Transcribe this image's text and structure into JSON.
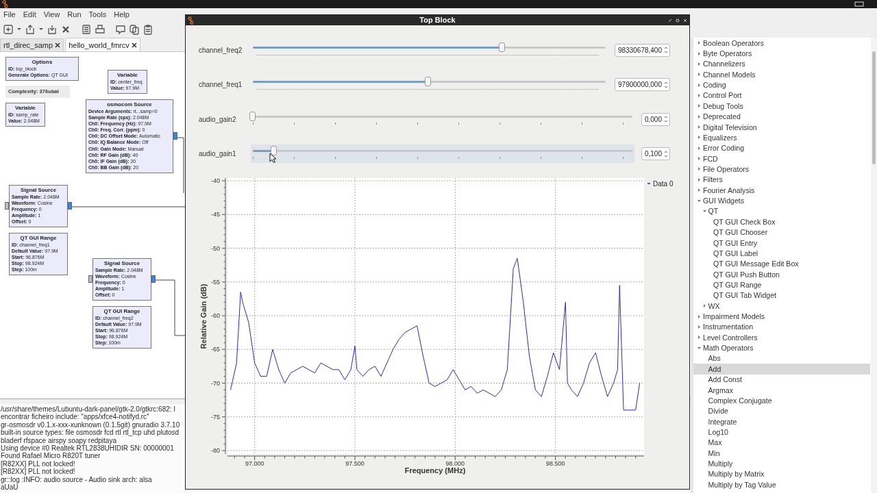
{
  "menu": [
    "File",
    "Edit",
    "View",
    "Run",
    "Tools",
    "Help"
  ],
  "tabs": [
    {
      "label": "rtl_direc_samp",
      "selected": false
    },
    {
      "label": "hello_world_fmrcv",
      "selected": true
    }
  ],
  "flowgraph": {
    "complexity": "Complexity: 376ubal",
    "blocks": [
      {
        "title": "Options",
        "params": [
          "**ID:** top_block",
          "**Generate Options:** QT GUI"
        ],
        "has_input": false,
        "has_output": false
      },
      {
        "title": "Variable",
        "params": [
          "**ID:** center_freq",
          "**Value:** 97.9M"
        ],
        "has_input": false,
        "has_output": false
      },
      {
        "title": "Variable",
        "params": [
          "**ID:** samp_rate",
          "**Value:** 2.048M"
        ],
        "has_input": false,
        "has_output": false
      },
      {
        "title": "osmocom Source",
        "params": [
          "**Device Arguments:** rt...samp=0",
          "**Sample Rate (sps):** 2.048M",
          "**Ch0: Frequency (Hz):** 97.9M",
          "**Ch0: Freq. Corr. (ppm):** 0",
          "**Ch0: DC Offset Mode:** Automatic",
          "**Ch0: IQ Balance Mode:** Off",
          "**Ch0: Gain Mode:** Manual",
          "**Ch0: RF Gain (dB):** 40",
          "**Ch0: IF Gain (dB):** 20",
          "**Ch0: BB Gain (dB):** 20"
        ],
        "has_input": false,
        "has_output": true
      },
      {
        "title": "Signal Source",
        "params": [
          "**Sample Rate:** 2.048M",
          "**Waveform:** Cosine",
          "**Frequency:** 0",
          "**Amplitude:** 1",
          "**Offset:** 0"
        ],
        "has_input": true,
        "has_output": true
      },
      {
        "title": "QT GUI Range",
        "params": [
          "**ID:** channel_freq1",
          "**Default Value:** 97.9M",
          "**Start:** 96.876M",
          "**Stop:** 98.924M",
          "**Step:** 100m"
        ],
        "has_input": false,
        "has_output": false
      },
      {
        "title": "Signal Source",
        "params": [
          "**Sample Rate:** 2.048M",
          "**Waveform:** Cosine",
          "**Frequency:** 0",
          "**Amplitude:** 1",
          "**Offset:** 0"
        ],
        "has_input": true,
        "has_output": true
      },
      {
        "title": "QT GUI Range",
        "params": [
          "**ID:** channel_freq2",
          "**Default Value:** 97.9M",
          "**Start:** 96.876M",
          "**Stop:** 98.924M",
          "**Step:** 100m"
        ],
        "has_input": false,
        "has_output": false
      }
    ]
  },
  "console": [
    "/usr/share/themes/Lubuntu-dark-panel/gtk-2.0/gtkrc:682: I",
    "encontrar ficheiro include: \"apps/xfce4-notifyd.rc\"",
    "gr-osmosdr v0.1.x-xxx-xunknown (0.1.5git) gnuradio 3.7.10",
    "built-in source types: file osmosdr fcd rtl rtl_tcp uhd plutosd",
    "bladerf rfspace airspy soapy redpitaya",
    "Using device #0 Realtek RTL2838UHIDIR SN: 00000001",
    "Found Rafael Micro R820T tuner",
    "[R82XX] PLL not locked!",
    "[R82XX] PLL not locked!",
    "gr::log :INFO: audio source - Audio sink arch: alsa",
    "aUaU"
  ],
  "block_tree": [
    {
      "label": "Boolean Operators",
      "expanded": false,
      "selected": false
    },
    {
      "label": "Byte Operators",
      "expanded": false,
      "selected": false
    },
    {
      "label": "Channelizers",
      "expanded": false,
      "selected": false
    },
    {
      "label": "Channel Models",
      "expanded": false,
      "selected": false
    },
    {
      "label": "Coding",
      "expanded": false,
      "selected": false
    },
    {
      "label": "Control Port",
      "expanded": false,
      "selected": false
    },
    {
      "label": "Debug Tools",
      "expanded": false,
      "selected": false
    },
    {
      "label": "Deprecated",
      "expanded": false,
      "selected": false
    },
    {
      "label": "Digital Television",
      "expanded": false,
      "selected": false
    },
    {
      "label": "Equalizers",
      "expanded": false,
      "selected": false
    },
    {
      "label": "Error Coding",
      "expanded": false,
      "selected": false
    },
    {
      "label": "FCD",
      "expanded": false,
      "selected": false
    },
    {
      "label": "File Operators",
      "expanded": false,
      "selected": false
    },
    {
      "label": "Filters",
      "expanded": false,
      "selected": false
    },
    {
      "label": "Fourier Analysis",
      "expanded": false,
      "selected": false
    },
    {
      "label": "GUI Widgets",
      "expanded": true,
      "selected": false,
      "children": [
        {
          "label": "QT",
          "expanded": true,
          "selected": false,
          "children": [
            {
              "label": "QT GUI Check Box",
              "selected": false
            },
            {
              "label": "QT GUI Chooser",
              "selected": false
            },
            {
              "label": "QT GUI Entry",
              "selected": false
            },
            {
              "label": "QT GUI Label",
              "selected": false
            },
            {
              "label": "QT GUI Message Edit Box",
              "selected": false
            },
            {
              "label": "QT GUI Push Button",
              "selected": false
            },
            {
              "label": "QT GUI Range",
              "selected": false
            },
            {
              "label": "QT GUI Tab Widget",
              "selected": false
            }
          ]
        },
        {
          "label": "WX",
          "expanded": false,
          "selected": false
        }
      ]
    },
    {
      "label": "Impairment Models",
      "expanded": false,
      "selected": false
    },
    {
      "label": "Instrumentation",
      "expanded": false,
      "selected": false
    },
    {
      "label": "Level Controllers",
      "expanded": false,
      "selected": false
    },
    {
      "label": "Math Operators",
      "expanded": true,
      "selected": false,
      "children": [
        {
          "label": "Abs",
          "selected": false
        },
        {
          "label": "Add",
          "selected": true
        },
        {
          "label": "Add Const",
          "selected": false
        },
        {
          "label": "Argmax",
          "selected": false
        },
        {
          "label": "Complex Conjugate",
          "selected": false
        },
        {
          "label": "Divide",
          "selected": false
        },
        {
          "label": "Integrate",
          "selected": false
        },
        {
          "label": "Log10",
          "selected": false
        },
        {
          "label": "Max",
          "selected": false
        },
        {
          "label": "Min",
          "selected": false
        },
        {
          "label": "Multiply",
          "selected": false
        },
        {
          "label": "Multiply by Matrix",
          "selected": false
        },
        {
          "label": "Multiply by Tag Value",
          "selected": false
        }
      ]
    }
  ],
  "top_block": {
    "title": "Top Block",
    "sliders": [
      {
        "kind": "fine",
        "label": "channel_freq2",
        "level": 0.707,
        "value": "98330678,400",
        "hovered": false
      },
      {
        "kind": "fine",
        "label": "channel_freq1",
        "level": 0.498,
        "value": "97900000,000",
        "hovered": false
      },
      {
        "kind": "coarse",
        "label": "audio_gain2",
        "level": 0,
        "value": "0,000",
        "hovered": false
      },
      {
        "kind": "coarse",
        "label": "audio_gain1",
        "level": 0.056,
        "value": "0,100",
        "hovered": true
      }
    ],
    "chart_data": {
      "type": "line",
      "xlabel": "Frequency (MHz)",
      "ylabel": "Relative Gain (dB)",
      "x": [
        96.88,
        96.91,
        96.93,
        96.94,
        96.97,
        97.0,
        97.03,
        97.06,
        97.09,
        97.12,
        97.15,
        97.18,
        97.21,
        97.24,
        97.27,
        97.3,
        97.33,
        97.36,
        97.39,
        97.42,
        97.45,
        97.48,
        97.5,
        97.51,
        97.54,
        97.57,
        97.6,
        97.63,
        97.66,
        97.69,
        97.72,
        97.75,
        97.78,
        97.81,
        97.84,
        97.87,
        97.9,
        97.93,
        97.96,
        97.99,
        98.02,
        98.05,
        98.08,
        98.11,
        98.14,
        98.17,
        98.2,
        98.23,
        98.26,
        98.29,
        98.31,
        98.34,
        98.37,
        98.4,
        98.43,
        98.46,
        98.49,
        98.52,
        98.55,
        98.56,
        98.58,
        98.61,
        98.64,
        98.67,
        98.7,
        98.73,
        98.76,
        98.79,
        98.81,
        98.82,
        98.84,
        98.87,
        98.9,
        98.92
      ],
      "series": [
        {
          "name": "Data 0",
          "color": "#2a2ab4",
          "values": [
            -71,
            -67,
            -56.5,
            -58,
            -61,
            -67,
            -69,
            -69,
            -65,
            -68,
            -70,
            -68.5,
            -68,
            -67.5,
            -68,
            -68.5,
            -67,
            -67.5,
            -68,
            -68,
            -69.5,
            -68,
            -64.5,
            -68,
            -69,
            -68,
            -67.5,
            -69,
            -67,
            -65,
            -63.5,
            -62.5,
            -62,
            -61.5,
            -66,
            -70,
            -70.5,
            -70,
            -69.5,
            -68,
            -69.5,
            -71,
            -70.5,
            -71.5,
            -71,
            -71.5,
            -72,
            -71,
            -68,
            -53,
            -51.5,
            -58,
            -66,
            -71,
            -72,
            -69,
            -65.5,
            -68,
            -58,
            -70,
            -71,
            -72,
            -70,
            -67,
            -65.5,
            -69,
            -72,
            -70,
            -68,
            -55.5,
            -74,
            -74,
            -74,
            -70
          ]
        }
      ],
      "grid": true,
      "xlim": [
        96.8645,
        98.942
      ],
      "ylim": [
        -80,
        -40
      ],
      "xticks": [
        {
          "value": 97,
          "label": "97.000"
        },
        {
          "value": 97.5,
          "label": "97.500"
        },
        {
          "value": 98,
          "label": "98.000"
        },
        {
          "value": 98.5,
          "label": "98.500"
        }
      ],
      "yticks": [
        -40,
        -45,
        -50,
        -55,
        -60,
        -65,
        -70,
        -75,
        -80
      ]
    }
  }
}
